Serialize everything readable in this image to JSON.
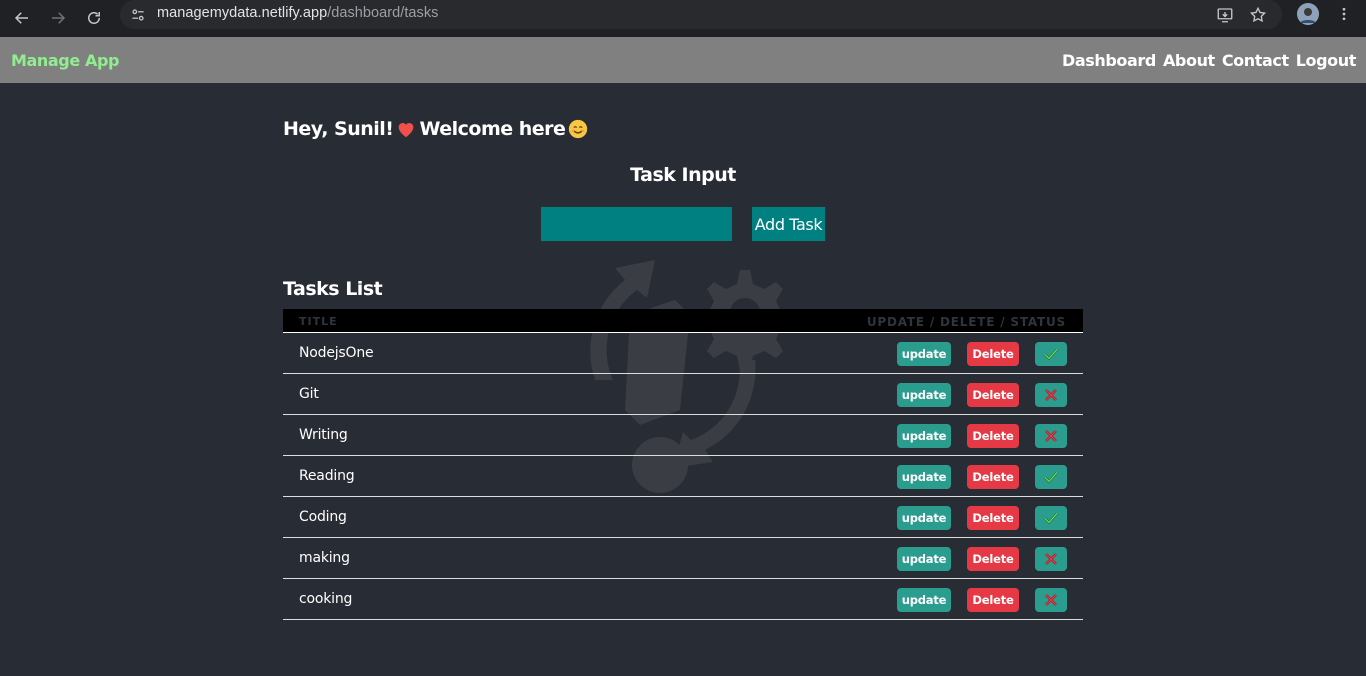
{
  "browser": {
    "url_host": "managemydata.netlify.app",
    "url_path": "/dashboard/tasks",
    "icons": [
      "back-icon",
      "forward-icon",
      "reload-icon",
      "site-info-icon",
      "install-app-icon",
      "bookmark-star-icon",
      "profile-avatar",
      "more-menu-icon"
    ]
  },
  "navbar": {
    "brand": "Manage App",
    "links": [
      "Dashboard",
      "About",
      "Contact",
      "Logout"
    ]
  },
  "greeting": {
    "hey": "Hey, Sunil!",
    "welcome": "Welcome here"
  },
  "task_input": {
    "title": "Task Input",
    "value": "",
    "button": "Add Task"
  },
  "tasks_list": {
    "title": "Tasks List",
    "col_title": "TITLE",
    "col_actions": "UPDATE / DELETE / STATUS",
    "update_label": "update",
    "delete_label": "Delete",
    "rows": [
      {
        "title": "NodejsOne",
        "done": true
      },
      {
        "title": "Git",
        "done": false
      },
      {
        "title": "Writing",
        "done": false
      },
      {
        "title": "Reading",
        "done": true
      },
      {
        "title": "Coding",
        "done": true
      },
      {
        "title": "making",
        "done": false
      },
      {
        "title": "cooking",
        "done": false
      }
    ]
  },
  "colors": {
    "page_bg": "#282c34",
    "navbar_bg": "#808080",
    "brand": "#90ee90",
    "teal": "#008080",
    "update_btn": "#2a9d8f",
    "delete_btn": "#e63946"
  }
}
